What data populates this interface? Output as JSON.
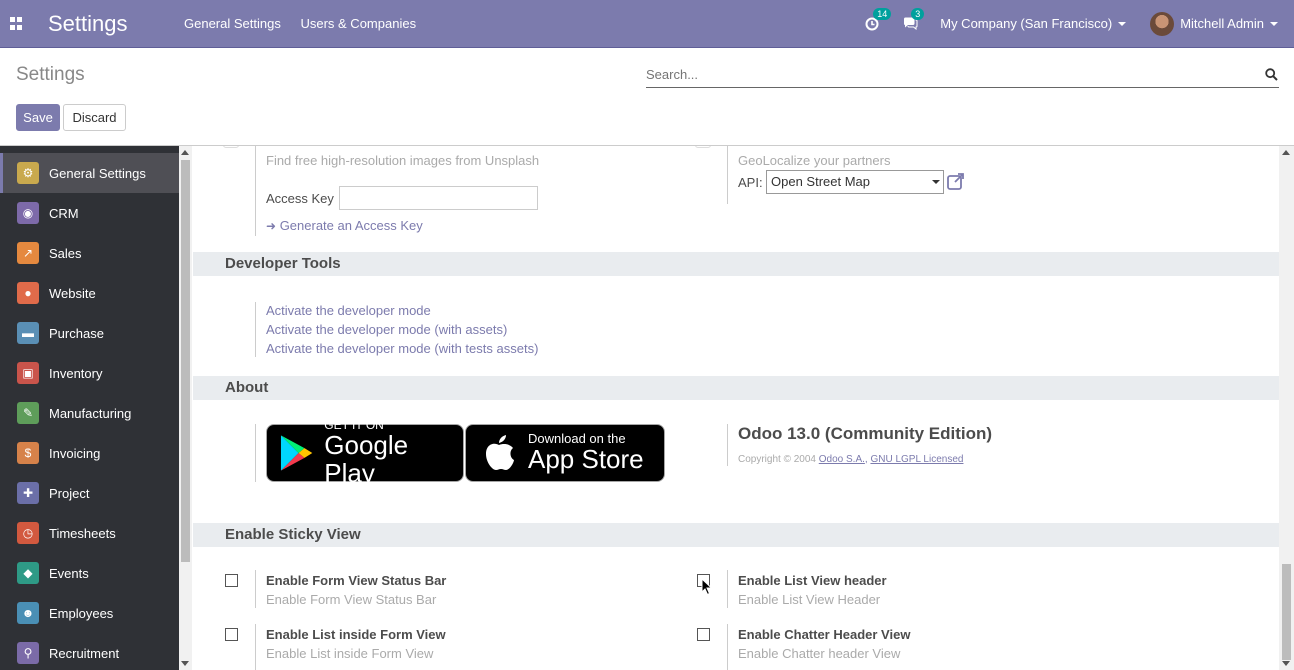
{
  "navbar": {
    "brand": "Settings",
    "menu": [
      "General Settings",
      "Users & Companies"
    ],
    "activity_count": "14",
    "message_count": "3",
    "company": "My Company (San Francisco)",
    "user": "Mitchell Admin"
  },
  "control_panel": {
    "title": "Settings",
    "search_placeholder": "Search...",
    "save_label": "Save",
    "discard_label": "Discard"
  },
  "sidebar": {
    "items": [
      {
        "label": "General Settings",
        "icon": "gear-icon",
        "color": "#c9a94e"
      },
      {
        "label": "CRM",
        "icon": "handshake-icon",
        "color": "#7d6aa9"
      },
      {
        "label": "Sales",
        "icon": "chart-icon",
        "color": "#e5893f"
      },
      {
        "label": "Website",
        "icon": "globe-icon",
        "color": "#e06b4a"
      },
      {
        "label": "Purchase",
        "icon": "card-icon",
        "color": "#5a8fb5"
      },
      {
        "label": "Inventory",
        "icon": "box-icon",
        "color": "#c9544b"
      },
      {
        "label": "Manufacturing",
        "icon": "wrench-icon",
        "color": "#5e9d5a"
      },
      {
        "label": "Invoicing",
        "icon": "dollar-icon",
        "color": "#d6824a"
      },
      {
        "label": "Project",
        "icon": "puzzle-icon",
        "color": "#6b6fa8"
      },
      {
        "label": "Timesheets",
        "icon": "clock-icon",
        "color": "#d2593f"
      },
      {
        "label": "Events",
        "icon": "ticket-icon",
        "color": "#2e9a86"
      },
      {
        "label": "Employees",
        "icon": "people-icon",
        "color": "#4a8fb5"
      },
      {
        "label": "Recruitment",
        "icon": "magnifier-icon",
        "color": "#7b6ba8"
      }
    ]
  },
  "unsplash": {
    "description": "Find free high-resolution images from Unsplash",
    "access_key_label": "Access Key",
    "access_key_value": "",
    "generate_link": "Generate an Access Key"
  },
  "geolocalize": {
    "description": "GeoLocalize your partners",
    "api_label": "API:",
    "api_value": "Open Street Map"
  },
  "developer_tools": {
    "title": "Developer Tools",
    "links": [
      "Activate the developer mode",
      "Activate the developer mode (with assets)",
      "Activate the developer mode (with tests assets)"
    ]
  },
  "about": {
    "title": "About",
    "google_play_small": "GET IT ON",
    "google_play_big": "Google Play",
    "app_store_small": "Download on the",
    "app_store_big": "App Store",
    "version": "Odoo 13.0 (Community Edition)",
    "copyright": "Copyright © 2004",
    "company_link": "Odoo S.A.",
    "license_link": "GNU LGPL Licensed"
  },
  "sticky_view": {
    "title": "Enable Sticky View",
    "options": [
      {
        "label": "Enable Form View Status Bar",
        "help": "Enable Form View Status Bar",
        "checked": false
      },
      {
        "label": "Enable List View header",
        "help": "Enable List View Header",
        "checked": false
      },
      {
        "label": "Enable List inside Form View",
        "help": "Enable List inside Form View",
        "checked": false
      },
      {
        "label": "Enable Chatter Header View",
        "help": "Enable Chatter header View",
        "checked": false
      }
    ]
  }
}
